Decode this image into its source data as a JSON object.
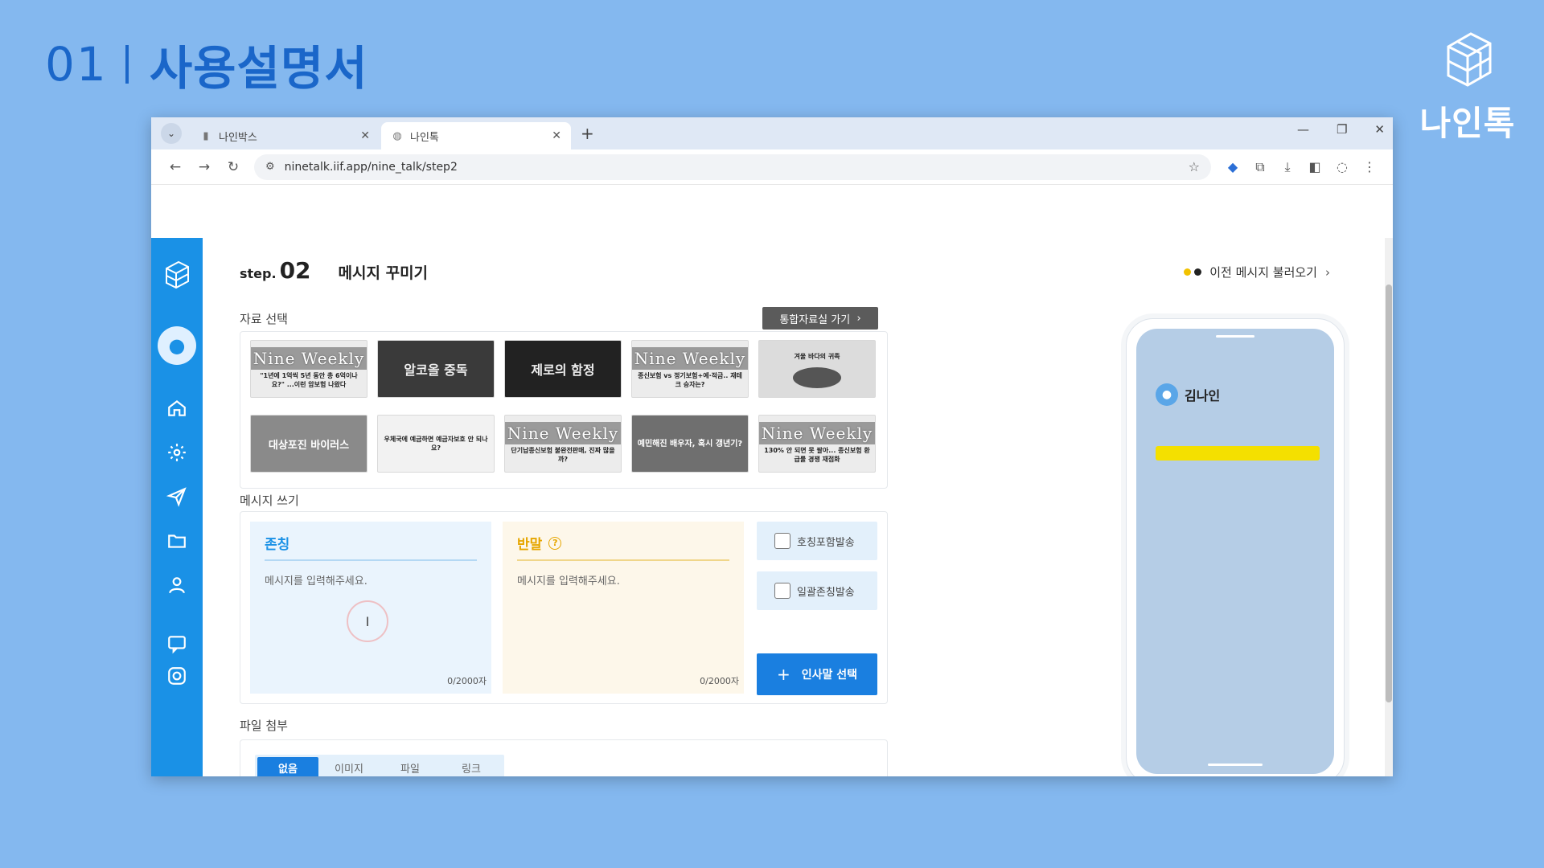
{
  "slide": {
    "number": "01",
    "title": "사용설명서",
    "brand": "나인톡"
  },
  "browser": {
    "tabs": [
      {
        "label": "나인박스",
        "active": false
      },
      {
        "label": "나인톡",
        "active": true
      }
    ],
    "url": "ninetalk.iif.app/nine_talk/step2"
  },
  "page": {
    "step_word": "step.",
    "step_num": "02",
    "step_title": "메시지 꾸미기",
    "load_prev": "이전 메시지 불러오기",
    "materials_label": "자료 선택",
    "goto_library": "통합자료실 가기",
    "thumbnails": [
      {
        "title": "Nine Weekly",
        "sub": "\"1년에 1억씩 5년 동안 총 6억이나요?\" ...이런 암보험 나왔다"
      },
      {
        "title": "알코올 중독",
        "sub": ""
      },
      {
        "title": "제로의 함정",
        "sub": ""
      },
      {
        "title": "Nine Weekly",
        "sub": "종신보험 vs 정기보험+예·적금.. 재테크 승자는?"
      },
      {
        "title": "",
        "sub": "겨울 바다의 귀족"
      },
      {
        "title": "대상포진 바이러스",
        "sub": ""
      },
      {
        "title": "",
        "sub": "우체국에 예금하면 예금자보호 안 되나요?"
      },
      {
        "title": "Nine Weekly",
        "sub": "단기납종신보험 불완전판매, 진짜 많을까?"
      },
      {
        "title": "",
        "sub": "예민해진 배우자, 혹시 갱년기?"
      },
      {
        "title": "Nine Weekly",
        "sub": "130% 안 되면 못 팔아... 종신보험 환급률 경쟁 재점화"
      }
    ],
    "write_label": "메시지 쓰기",
    "formal": {
      "title": "존칭",
      "placeholder": "메시지를 입력해주세요.",
      "counter": "0/2000자"
    },
    "casual": {
      "title": "반말",
      "placeholder": "메시지를 입력해주세요.",
      "counter": "0/2000자"
    },
    "options": [
      "호칭포함발송",
      "일괄존칭발송"
    ],
    "greeting_button": "인사말 선택",
    "file_label": "파일 첨부",
    "file_options": [
      "없음",
      "이미지",
      "파일",
      "링크"
    ],
    "file_selected": "없음"
  },
  "preview": {
    "sender": "김나인"
  },
  "colors": {
    "accent": "#1a91e6",
    "slide_bg": "#84b8ef",
    "bubble": "#f4e000"
  }
}
